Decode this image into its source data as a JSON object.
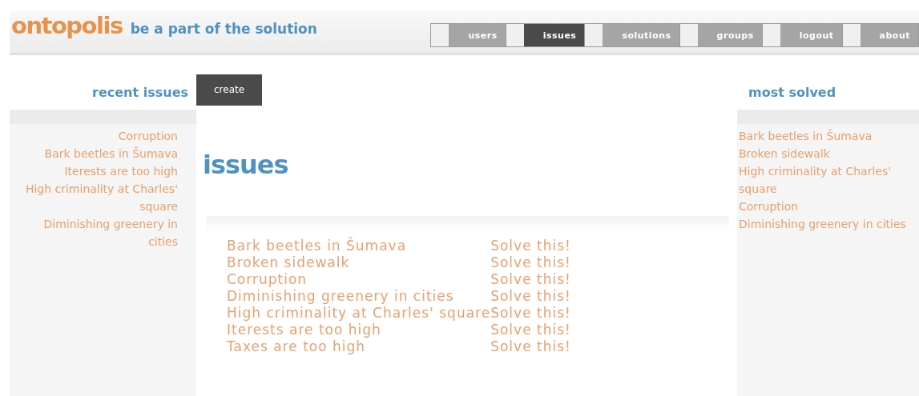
{
  "header": {
    "logo": "ontopolis",
    "tagline": "be a part of the solution"
  },
  "nav": [
    {
      "label": "users",
      "selected": false
    },
    {
      "label": "issues",
      "selected": true
    },
    {
      "label": "solutions",
      "selected": false
    },
    {
      "label": "groups",
      "selected": false
    },
    {
      "label": "logout",
      "selected": false
    },
    {
      "label": "about",
      "selected": false
    }
  ],
  "recent_issues": {
    "title": "recent issues",
    "items": [
      "Corruption",
      "Bark beetles in Šumava",
      "Iterests are too high",
      "High criminality at Charles' square",
      "Diminishing greenery in cities"
    ]
  },
  "main": {
    "create_button": "create",
    "title": "issues",
    "rows": [
      {
        "issue": "Bark beetles in Šumava",
        "action": "Solve this!"
      },
      {
        "issue": "Broken sidewalk",
        "action": "Solve this!"
      },
      {
        "issue": "Corruption",
        "action": "Solve this!"
      },
      {
        "issue": "Diminishing greenery in cities",
        "action": "Solve this!"
      },
      {
        "issue": "High criminality at Charles' square",
        "action": "Solve this!"
      },
      {
        "issue": "Iterests are too high",
        "action": "Solve this!"
      },
      {
        "issue": "Taxes are too high",
        "action": "Solve this!"
      }
    ]
  },
  "most_solved": {
    "title": "most solved",
    "items": [
      "Bark beetles in Šumava",
      "Broken sidewalk",
      "High criminality at Charles' square",
      "Corruption",
      "Diminishing greenery in cities"
    ]
  }
}
